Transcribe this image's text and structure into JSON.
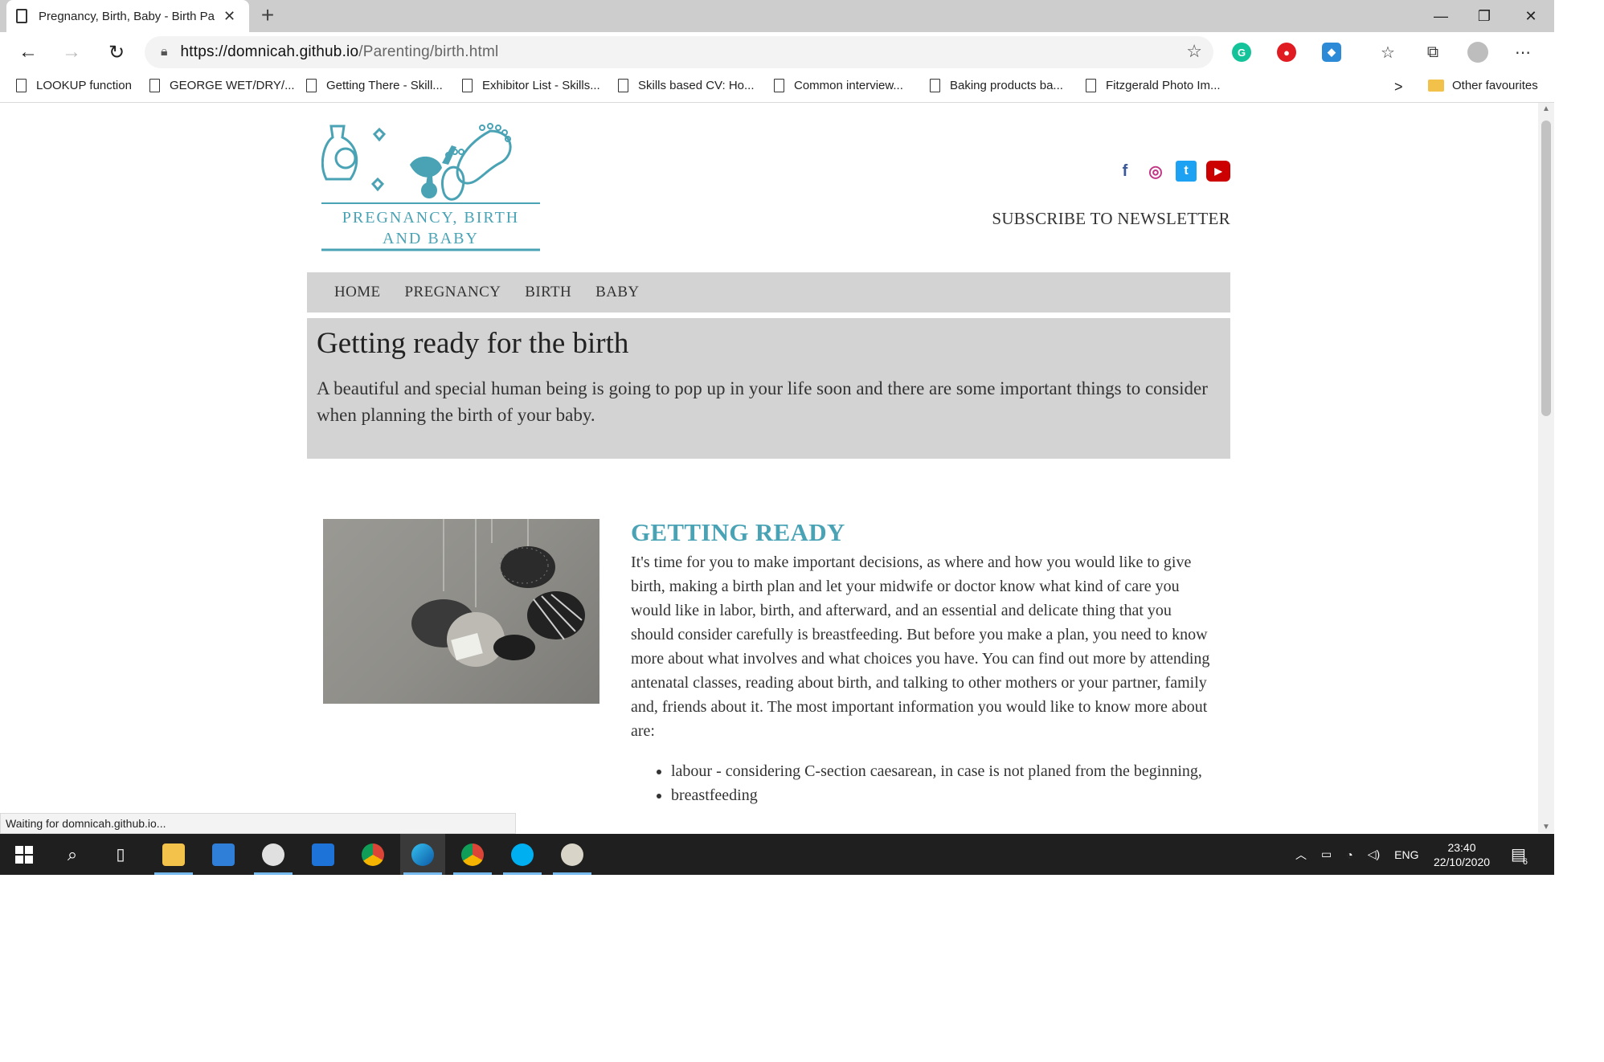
{
  "browser": {
    "tab_title": "Pregnancy, Birth, Baby - Birth Pa",
    "tab_close": "✕",
    "new_tab": "+",
    "window_minimize": "—",
    "window_restore": "❐",
    "window_close": "✕",
    "url_host": "https://domnicah.github.io",
    "url_path": "/Parenting/birth.html",
    "favourites": [
      "LOOKUP function",
      "GEORGE WET/DRY/...",
      "Getting There - Skill...",
      "Exhibitor List - Skills...",
      "Skills based CV: Ho...",
      "Common interview...",
      "Baking products ba...",
      "Fitzgerald Photo Im..."
    ],
    "favourites_more": ">",
    "other_favourites": "Other favourites",
    "status_text": "Waiting for domnicah.github.io..."
  },
  "site": {
    "logo_line1": "PREGNANCY, BIRTH",
    "logo_line2": "AND BABY",
    "social": [
      {
        "name": "facebook",
        "glyph": "f",
        "color": "#3b5998"
      },
      {
        "name": "instagram",
        "glyph": "◎",
        "color": "#c13584"
      },
      {
        "name": "twitter",
        "glyph": "t",
        "color": "#1da1f2"
      },
      {
        "name": "youtube",
        "glyph": "▶",
        "color": "#cc0000"
      }
    ],
    "subscribe": "SUBSCRIBE TO NEWSLETTER",
    "menu": [
      "HOME",
      "PREGNANCY",
      "BIRTH",
      "BABY"
    ],
    "hero_title": "Getting ready for the birth",
    "hero_text": "A beautiful and special human being is going to pop up in your life soon and there are some important things to consider when planning the birth of your baby.",
    "section_title": "GETTING READY",
    "section_text": "It's time for you to make important decisions, as where and how you would like to give birth, making a birth plan and let your midwife or doctor know what kind of care you would like in labor, birth, and afterward, and an essential and delicate thing that you should consider carefully is breastfeeding. But before you make a plan, you need to know more about what involves and what choices you have. You can find out more by attending antenatal classes, reading about birth, and talking to other mothers or your partner, family and, friends about it. The most important information you would like to know more about are:",
    "list": [
      "labour - considering C-section caesarean, in case is not planed from the beginning,",
      "breastfeeding"
    ],
    "accent_color": "#4aa3b5"
  },
  "taskbar": {
    "language": "ENG",
    "time": "23:40",
    "date": "22/10/2020",
    "notification_count": "6"
  }
}
